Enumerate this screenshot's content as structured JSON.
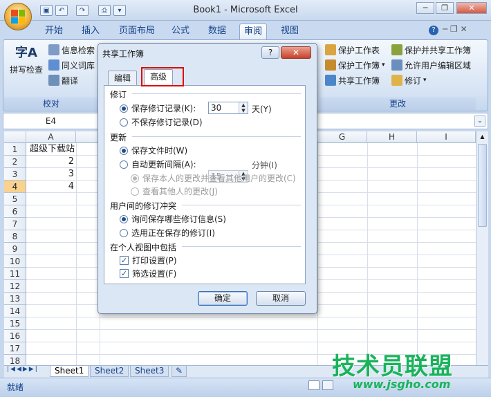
{
  "window": {
    "title": "Book1 - Microsoft Excel",
    "minimize": "─",
    "restore": "❐",
    "close": "✕"
  },
  "ribbon": {
    "tabs": [
      {
        "label": "开始"
      },
      {
        "label": "插入"
      },
      {
        "label": "页面布局"
      },
      {
        "label": "公式"
      },
      {
        "label": "数据"
      },
      {
        "label": "审阅"
      },
      {
        "label": "视图"
      }
    ],
    "active_tab": "审阅",
    "proofing": {
      "spell_check": "拼写检查",
      "research": "信息检索",
      "thesaurus": "同义词库",
      "translate": "翻译",
      "group_label": "校对"
    },
    "changes": {
      "protect_sheet": "保护工作表",
      "protect_workbook": "保护工作簿",
      "share_workbook": "共享工作簿",
      "protect_and_share": "保护并共享工作簿",
      "allow_edit_ranges": "允许用户编辑区域",
      "track_changes": "修订",
      "group_label": "更改"
    }
  },
  "formula_bar": {
    "name_box": "E4"
  },
  "grid": {
    "columns": [
      "A",
      "G",
      "H",
      "I"
    ],
    "rows": [
      "1",
      "2",
      "3",
      "4",
      "5",
      "6",
      "7",
      "8",
      "9",
      "10",
      "11",
      "12",
      "13",
      "14",
      "15",
      "16",
      "17",
      "18"
    ],
    "cells": {
      "a1": "超级下载站",
      "a2": "2",
      "a3": "3",
      "a4": "4"
    }
  },
  "sheets": [
    "Sheet1",
    "Sheet2",
    "Sheet3"
  ],
  "status": {
    "ready": "就绪"
  },
  "dialog": {
    "title": "共享工作簿",
    "help": "?",
    "close": "✕",
    "tabs": {
      "edit": "编辑",
      "advanced": "高级"
    },
    "track": {
      "heading": "修订",
      "keep_history": "保存修订记录(K):",
      "days_value": "30",
      "days_unit": "天(Y)",
      "no_history": "不保存修订记录(D)"
    },
    "update": {
      "heading": "更新",
      "on_save": "保存文件时(W)",
      "auto_every": "自动更新间隔(A):",
      "minutes_value": "15",
      "minutes_unit": "分钟(I)",
      "save_and_see": "保存本人的更改并查看其他用户的更改(C)",
      "just_see": "查看其他人的更改(J)"
    },
    "conflict": {
      "heading": "用户间的修订冲突",
      "ask": "询问保存哪些修订信息(S)",
      "saved_wins": "选用正在保存的修订(I)"
    },
    "personal": {
      "heading": "在个人视图中包括",
      "print_settings": "打印设置(P)",
      "filter_settings": "筛选设置(F)"
    },
    "ok": "确定",
    "cancel": "取消"
  },
  "watermark": {
    "text": "技术员联盟",
    "url": "www.jsgho.com"
  }
}
